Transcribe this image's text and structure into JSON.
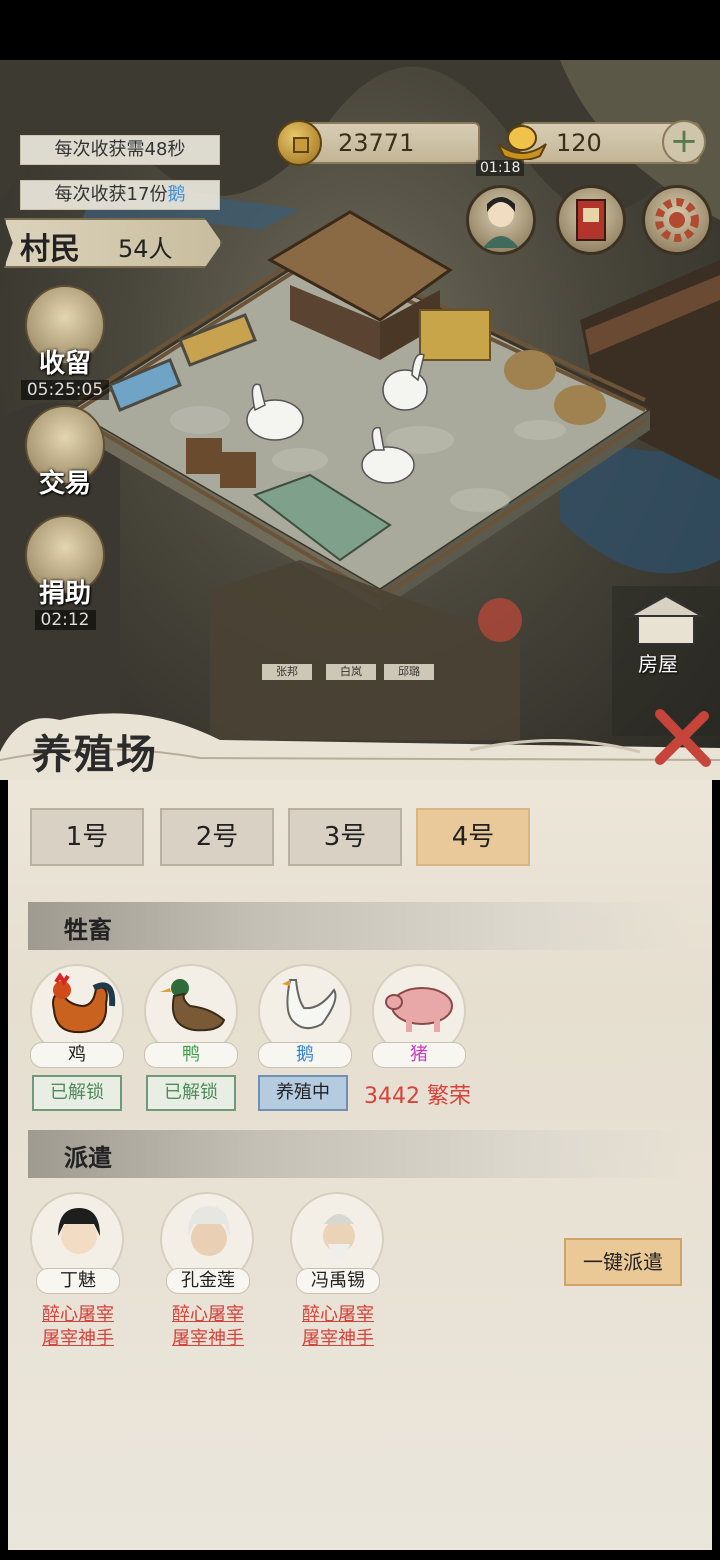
{
  "hud": {
    "harvest_time": "每次收获需48秒",
    "harvest_amount_prefix": "每次收获17份",
    "harvest_amount_item": "鹅",
    "coins": "23771",
    "ingots": "120",
    "small_timer": "01:18",
    "villagers_label": "村民",
    "villagers_value": "54人"
  },
  "side_menu": [
    {
      "label": "收留",
      "timer": "05:25:05"
    },
    {
      "label": "交易",
      "timer": ""
    },
    {
      "label": "捐助",
      "timer": "02:12"
    }
  ],
  "scene_tags": [
    "张邦",
    "白岚",
    "邱璐"
  ],
  "house_label": "房屋",
  "panel": {
    "title": "养殖场",
    "tabs": [
      "1号",
      "2号",
      "3号",
      "4号"
    ],
    "active_tab": "4号",
    "livestock_section": "牲畜",
    "animals": [
      {
        "name": "鸡",
        "color": "#222222",
        "status": "已解锁"
      },
      {
        "name": "鸭",
        "color": "#3aa34a",
        "status": "已解锁"
      },
      {
        "name": "鹅",
        "color": "#2f84d6",
        "status": "养殖中"
      },
      {
        "name": "猪",
        "color": "#c63fc3",
        "status": "3442 繁荣"
      }
    ],
    "dispatch_section": "派遣",
    "people": [
      {
        "name": "丁魅",
        "skill1": "醉心屠宰",
        "skill2": "屠宰神手"
      },
      {
        "name": "孔金莲",
        "skill1": "醉心屠宰",
        "skill2": "屠宰神手"
      },
      {
        "name": "冯禹锡",
        "skill1": "醉心屠宰",
        "skill2": "屠宰神手"
      }
    ],
    "dispatch_button": "一键派遣"
  },
  "colors": {
    "accent_tab": "#e9c899",
    "skill_red": "#d7423a",
    "breeding_blue": "#b4cbe0",
    "unlocked_green": "#4f8a5a"
  }
}
